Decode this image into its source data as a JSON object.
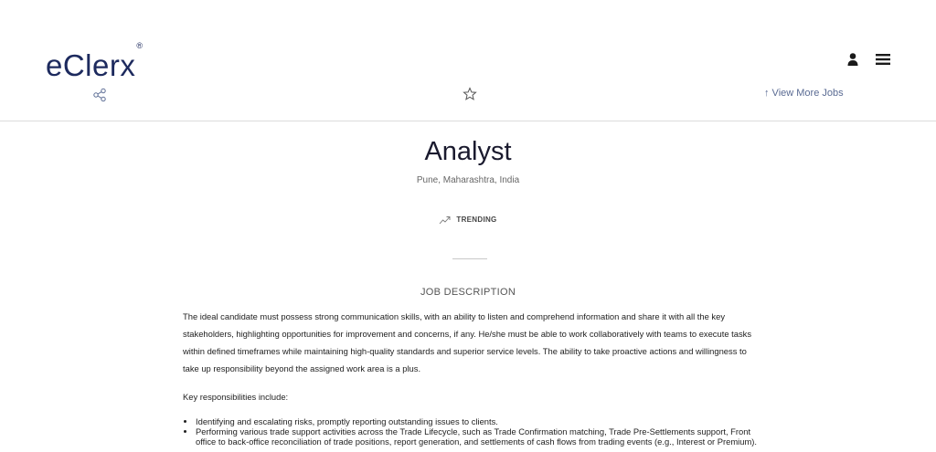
{
  "header": {
    "logo_text": "eClerx",
    "logo_mark": "®",
    "view_more_jobs": "↑ View More Jobs",
    "icons": [
      "user-icon",
      "menu-icon",
      "share-icon",
      "star-icon"
    ],
    "brand_color": "#1d2a5e",
    "link_color": "#5a6b93"
  },
  "job": {
    "title": "Analyst",
    "location": "Pune, Maharashtra, India",
    "trending_label": "TRENDING",
    "section_heading": "JOB DESCRIPTION",
    "description": "The ideal candidate must possess strong communication skills, with an ability to listen and comprehend information and share it with all the key stakeholders, highlighting opportunities for improvement and concerns, if any. He/she must be able to work collaboratively with teams to execute tasks within defined timeframes while maintaining high-quality standards and superior service levels. The ability to take proactive actions and willingness to take up responsibility beyond the assigned work area is a plus.",
    "responsibilities_heading": "Key responsibilities include:",
    "responsibilities": [
      "Identifying and escalating risks, promptly reporting outstanding issues to clients.",
      "Performing various trade support activities across the Trade Lifecycle, such as Trade Confirmation matching, Trade Pre-Settlements support, Front office to back-office reconciliation of trade positions, report generation, and settlements of cash flows from trading events (e.g., Interest or Premium)."
    ]
  }
}
